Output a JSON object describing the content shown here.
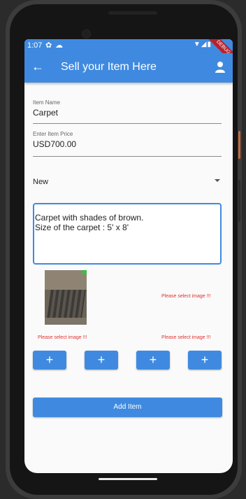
{
  "status_bar": {
    "time": "1:07",
    "debug_banner": "DEBUG"
  },
  "app_bar": {
    "title": "Sell your Item Here"
  },
  "form": {
    "item_name": {
      "label": "Item Name",
      "value": "Carpet"
    },
    "item_price": {
      "label": "Enter Item Price",
      "value": "USD700.00"
    },
    "condition": {
      "selected": "New"
    },
    "description": {
      "line1": "Carpet with shades of brown.",
      "line2": "Size of the carpet : 5' x 8'"
    },
    "image_errors": {
      "slot2": "Please select image !!!",
      "slot3": "Please select image !!!",
      "slot4": "Please select image !!!"
    },
    "add_image_buttons": [
      "+",
      "+",
      "+",
      "+"
    ],
    "submit_label": "Add Item"
  },
  "colors": {
    "primary": "#3f8ae0",
    "error": "#dd3333"
  }
}
